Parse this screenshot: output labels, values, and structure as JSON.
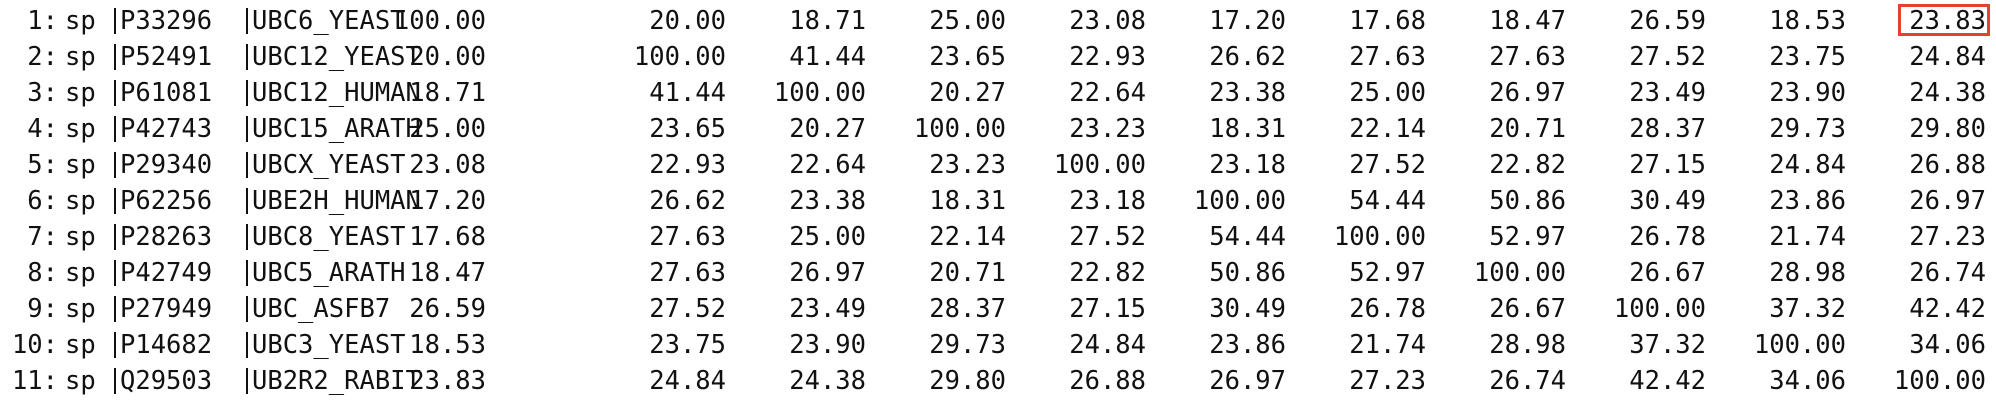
{
  "matrix": {
    "highlight_color": "#e2432e",
    "rows": [
      {
        "index": "1:",
        "db": "sp",
        "accession": "P33296",
        "name": "UBC6_YEAST",
        "values": [
          "100.00",
          "20.00",
          "18.71",
          "25.00",
          "23.08",
          "17.20",
          "17.68",
          "18.47",
          "26.59",
          "18.53",
          "23.83"
        ]
      },
      {
        "index": "2:",
        "db": "sp",
        "accession": "P52491",
        "name": "UBC12_YEAST",
        "values": [
          "20.00",
          "100.00",
          "41.44",
          "23.65",
          "22.93",
          "26.62",
          "27.63",
          "27.63",
          "27.52",
          "23.75",
          "24.84"
        ]
      },
      {
        "index": "3:",
        "db": "sp",
        "accession": "P61081",
        "name": "UBC12_HUMAN",
        "values": [
          "18.71",
          "41.44",
          "100.00",
          "20.27",
          "22.64",
          "23.38",
          "25.00",
          "26.97",
          "23.49",
          "23.90",
          "24.38"
        ]
      },
      {
        "index": "4:",
        "db": "sp",
        "accession": "P42743",
        "name": "UBC15_ARATH",
        "values": [
          "25.00",
          "23.65",
          "20.27",
          "100.00",
          "23.23",
          "18.31",
          "22.14",
          "20.71",
          "28.37",
          "29.73",
          "29.80"
        ]
      },
      {
        "index": "5:",
        "db": "sp",
        "accession": "P29340",
        "name": "UBCX_YEAST",
        "values": [
          "23.08",
          "22.93",
          "22.64",
          "23.23",
          "100.00",
          "23.18",
          "27.52",
          "22.82",
          "27.15",
          "24.84",
          "26.88"
        ]
      },
      {
        "index": "6:",
        "db": "sp",
        "accession": "P62256",
        "name": "UBE2H_HUMAN",
        "values": [
          "17.20",
          "26.62",
          "23.38",
          "18.31",
          "23.18",
          "100.00",
          "54.44",
          "50.86",
          "30.49",
          "23.86",
          "26.97"
        ]
      },
      {
        "index": "7:",
        "db": "sp",
        "accession": "P28263",
        "name": "UBC8_YEAST",
        "values": [
          "17.68",
          "27.63",
          "25.00",
          "22.14",
          "27.52",
          "54.44",
          "100.00",
          "52.97",
          "26.78",
          "21.74",
          "27.23"
        ]
      },
      {
        "index": "8:",
        "db": "sp",
        "accession": "P42749",
        "name": "UBC5_ARATH",
        "values": [
          "18.47",
          "27.63",
          "26.97",
          "20.71",
          "22.82",
          "50.86",
          "52.97",
          "100.00",
          "26.67",
          "28.98",
          "26.74"
        ]
      },
      {
        "index": "9:",
        "db": "sp",
        "accession": "P27949",
        "name": "UBC_ASFB7",
        "values": [
          "26.59",
          "27.52",
          "23.49",
          "28.37",
          "27.15",
          "30.49",
          "26.78",
          "26.67",
          "100.00",
          "37.32",
          "42.42"
        ]
      },
      {
        "index": "10:",
        "db": "sp",
        "accession": "P14682",
        "name": "UBC3_YEAST",
        "values": [
          "18.53",
          "23.75",
          "23.90",
          "29.73",
          "24.84",
          "23.86",
          "21.74",
          "28.98",
          "37.32",
          "100.00",
          "34.06"
        ]
      },
      {
        "index": "11:",
        "db": "sp",
        "accession": "Q29503",
        "name": "UB2R2_RABIT",
        "values": [
          "23.83",
          "24.84",
          "24.38",
          "29.80",
          "26.88",
          "26.97",
          "27.23",
          "26.74",
          "42.42",
          "34.06",
          "100.00"
        ]
      }
    ]
  }
}
